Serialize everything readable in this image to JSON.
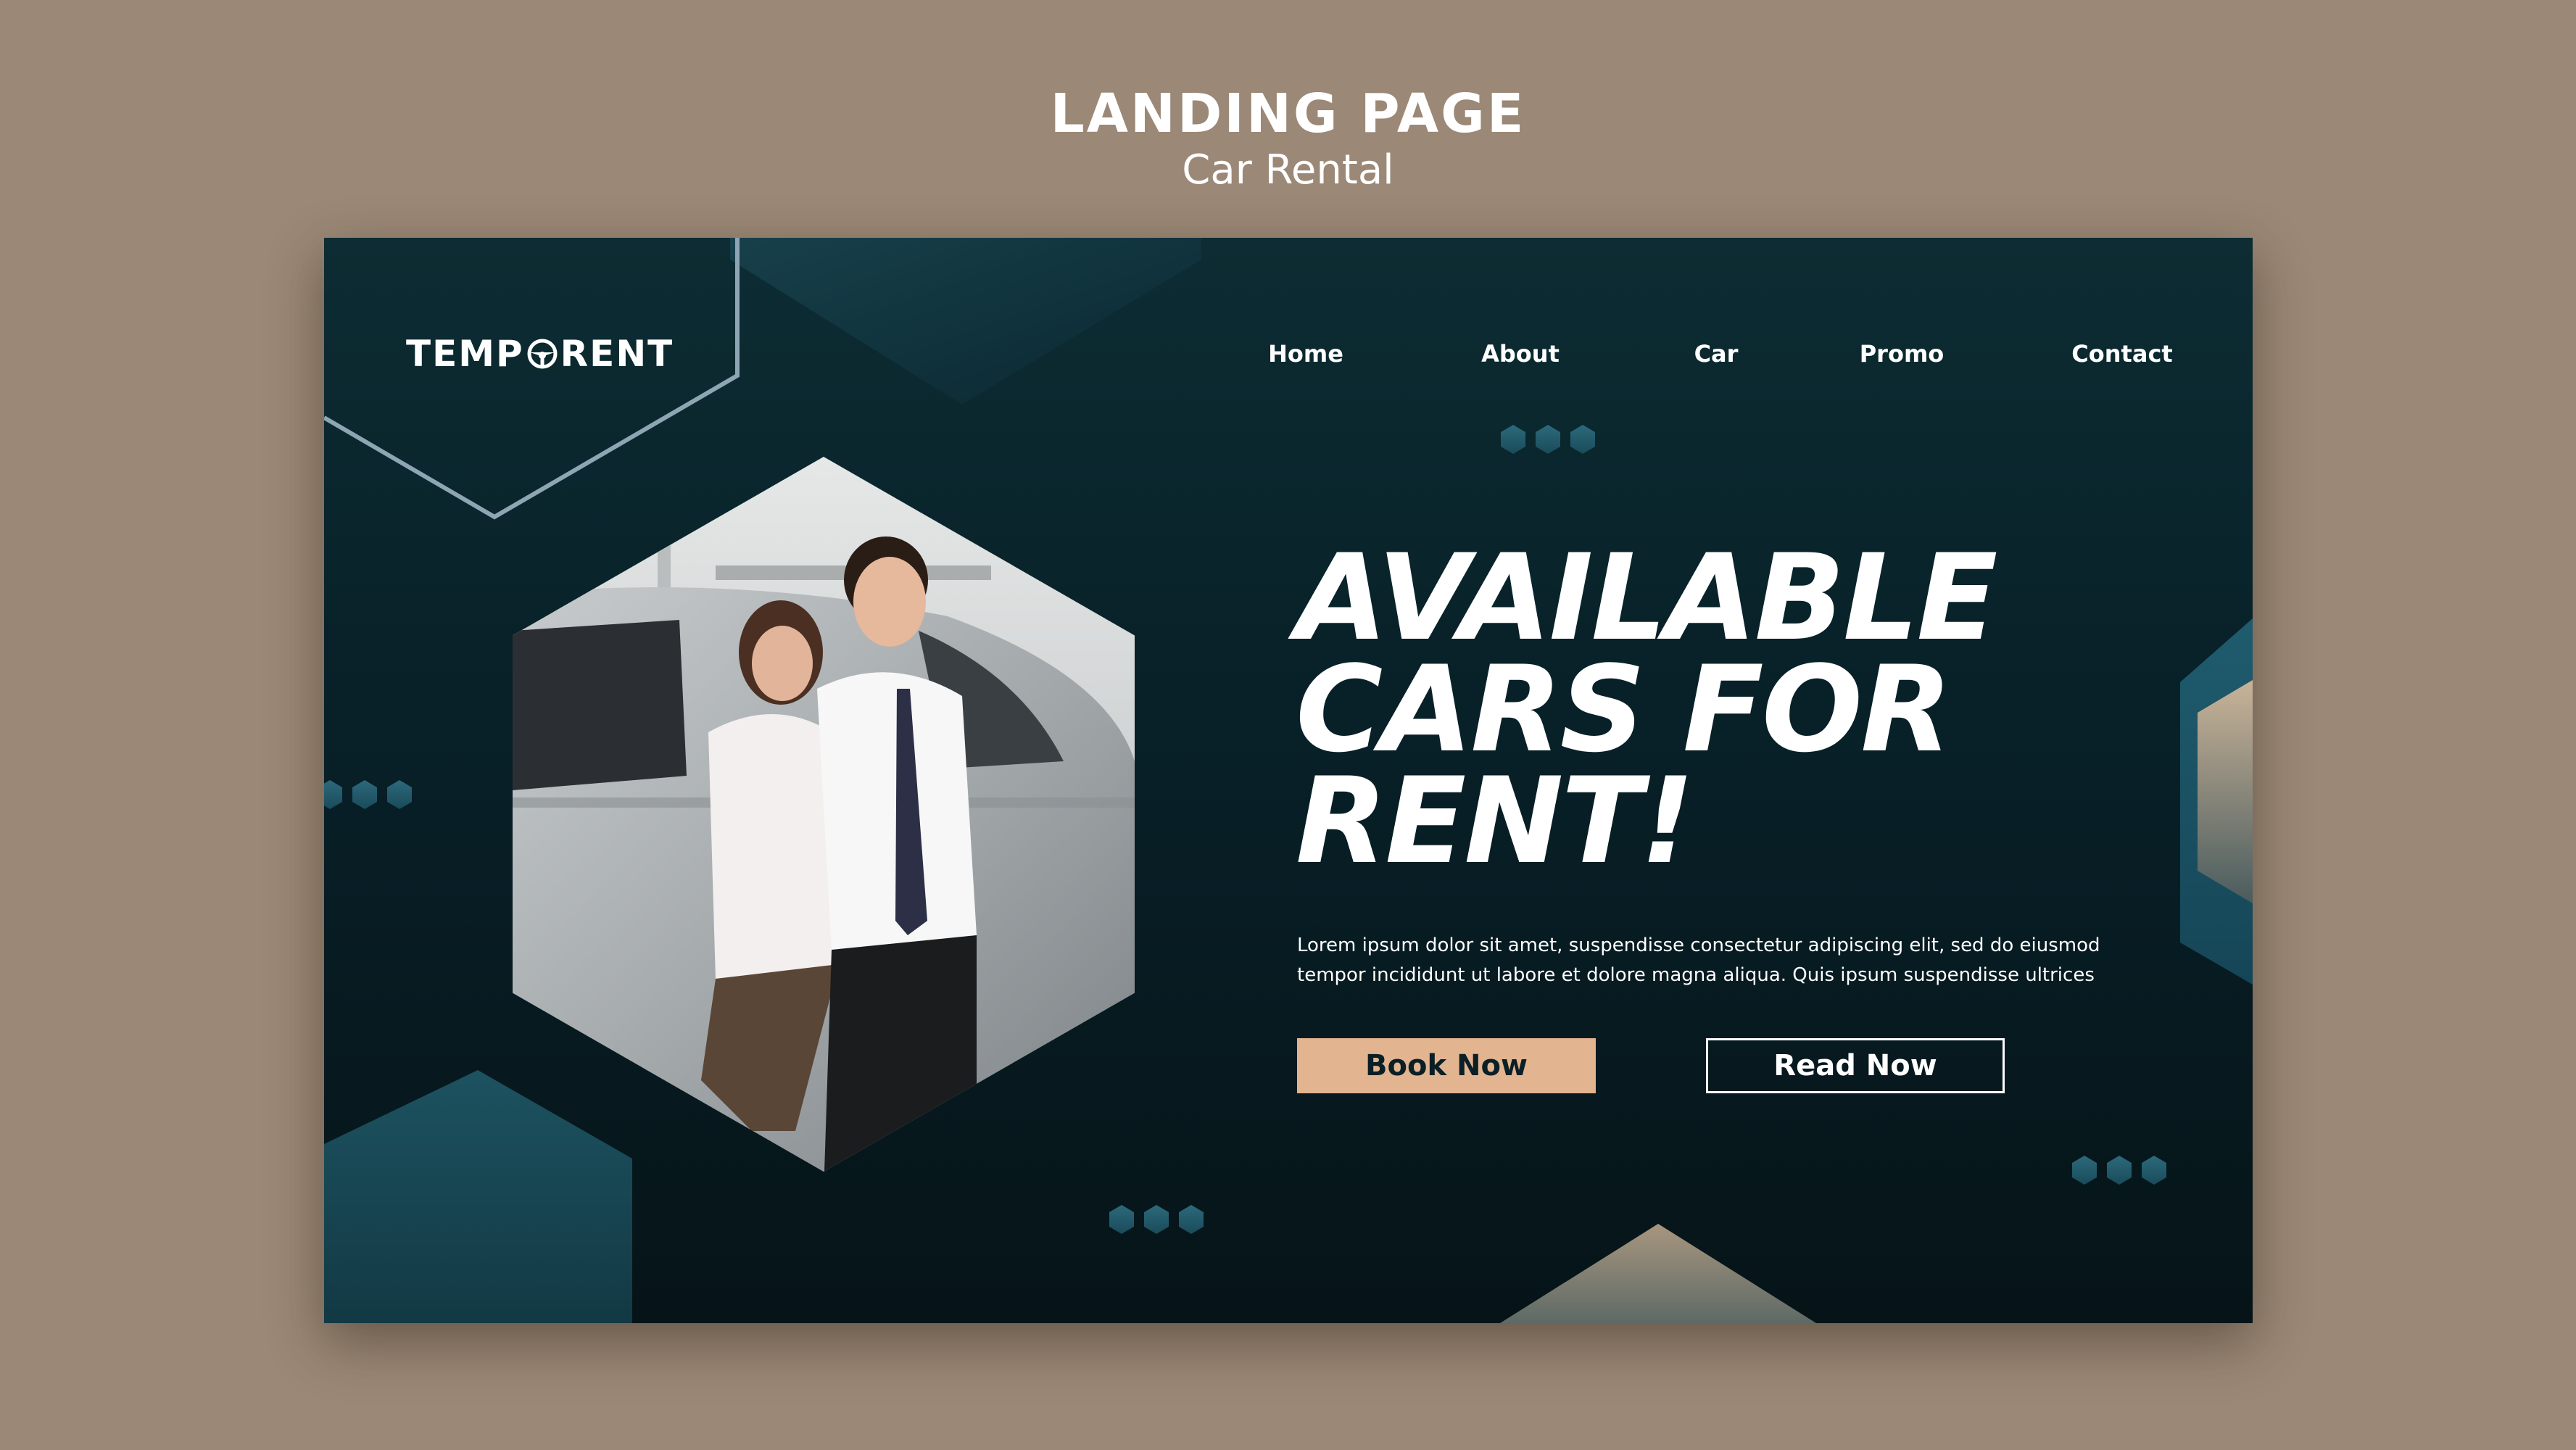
{
  "page": {
    "heading": "LANDING PAGE",
    "subheading": "Car Rental"
  },
  "brand": {
    "name_start": "TEMP",
    "name_end": "RENT",
    "icon": "steering-wheel-icon"
  },
  "nav": {
    "items": [
      {
        "label": "Home"
      },
      {
        "label": "About"
      },
      {
        "label": "Car"
      },
      {
        "label": "Promo"
      },
      {
        "label": "Contact"
      }
    ]
  },
  "hero": {
    "headline": [
      "AVAILABLE",
      "CARS FOR",
      "RENT!"
    ],
    "description": "Lorem ipsum dolor sit amet, suspendisse consectetur adipiscing elit, sed do eiusmod tempor incididunt ut labore et dolore magna aliqua. Quis ipsum suspendisse ultrices",
    "image": "couple-leaning-on-car-photo"
  },
  "buttons": {
    "book_label": "Book Now",
    "read_label": "Read Now"
  },
  "colors": {
    "outer_background": "#9b8876",
    "canvas_background": "#0b2129",
    "accent_button": "#e2b490",
    "teal_accent": "#1f5a6c"
  }
}
